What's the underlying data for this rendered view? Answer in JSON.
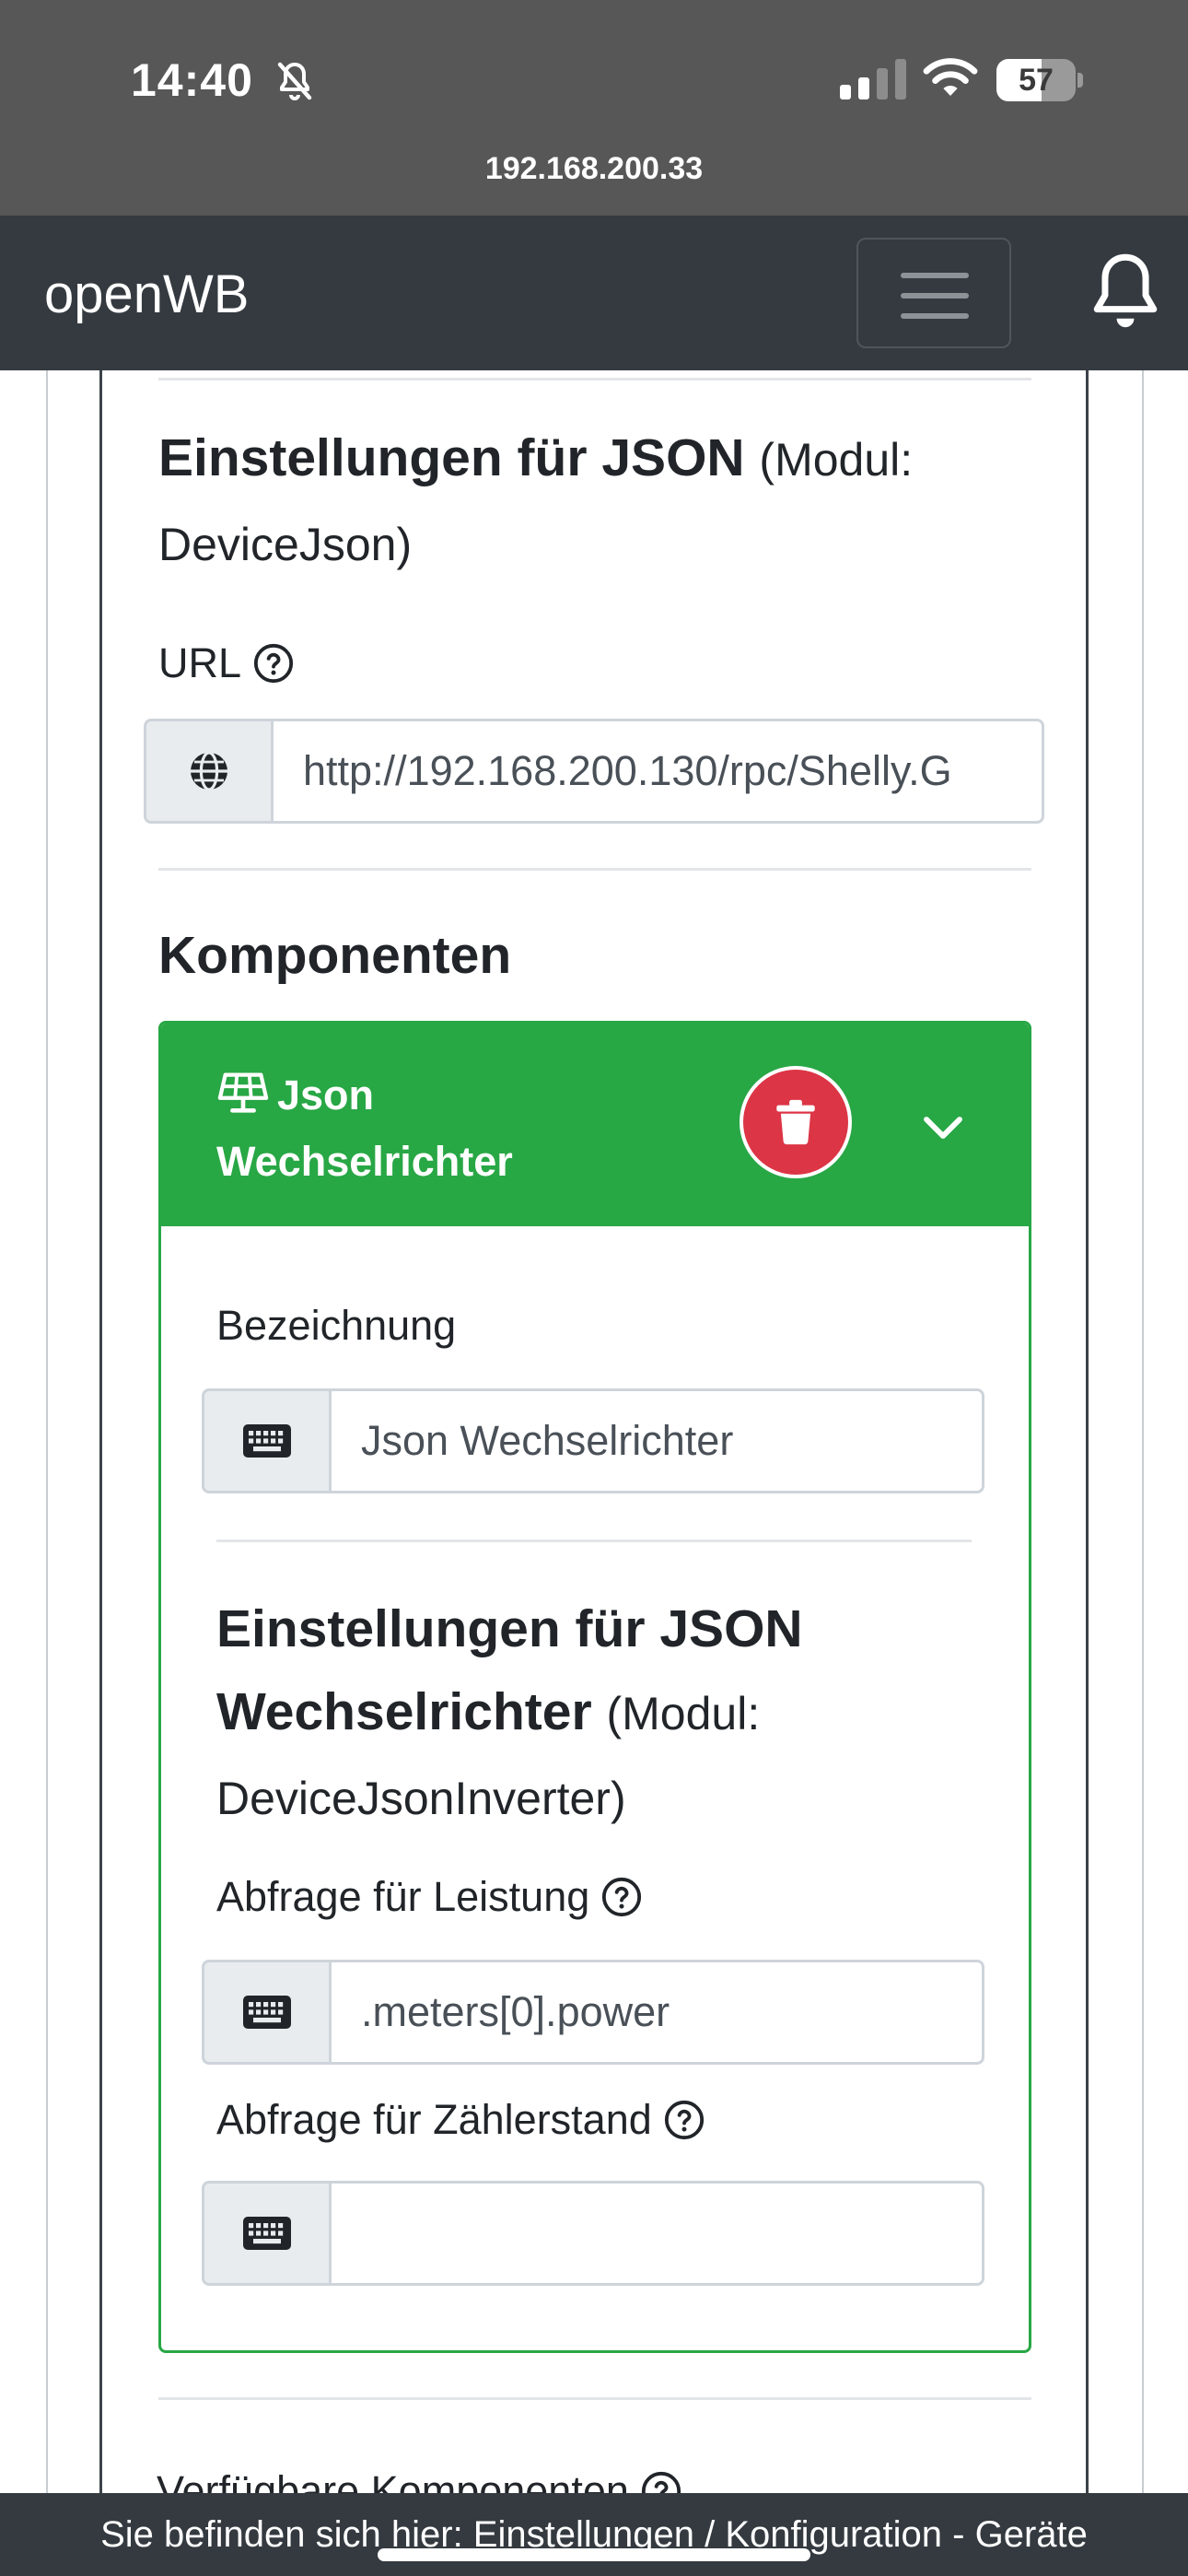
{
  "status_bar": {
    "time": "14:40",
    "battery": "57",
    "battery_level_percent": 57,
    "url": "192.168.200.33"
  },
  "navbar": {
    "brand": "openWB"
  },
  "device_settings": {
    "heading_bold": "Einstellungen für JSON",
    "heading_suffix": "(Modul:",
    "heading_line2": "DeviceJson)",
    "url_label": "URL",
    "url_value": "http://192.168.200.130/rpc/Shelly.G"
  },
  "components": {
    "heading": "Komponenten",
    "card": {
      "title_line1": "Json",
      "title_line2": "Wechselrichter",
      "name_label": "Bezeichnung",
      "name_value": "Json Wechselrichter",
      "settings_heading_line1": "Einstellungen für JSON",
      "settings_heading_line2_bold": "Wechselrichter",
      "settings_heading_line2_suffix": "(Modul:",
      "settings_heading_line3": "DeviceJsonInverter)",
      "power_label": "Abfrage für Leistung",
      "power_value": ".meters[0].power",
      "counter_label": "Abfrage für Zählerstand",
      "counter_value": ""
    }
  },
  "available_components_label": "Verfügbare Komponenten",
  "footer": {
    "breadcrumb": "Sie befinden sich hier: Einstellungen / Konfiguration - Geräte"
  },
  "colors": {
    "navbar": "#343a40",
    "status_bar": "#575757",
    "success": "#28a745",
    "danger": "#dc3545"
  },
  "icons": {
    "status_bell": "bell-slash-icon",
    "url_prepend": "globe-icon",
    "keyboard_prepend": "keyboard-icon",
    "component_type": "solar-panel-icon",
    "delete": "trash-icon",
    "expand": "chevron-down-icon",
    "help": "question-circle-icon",
    "notifications": "bell-icon"
  }
}
